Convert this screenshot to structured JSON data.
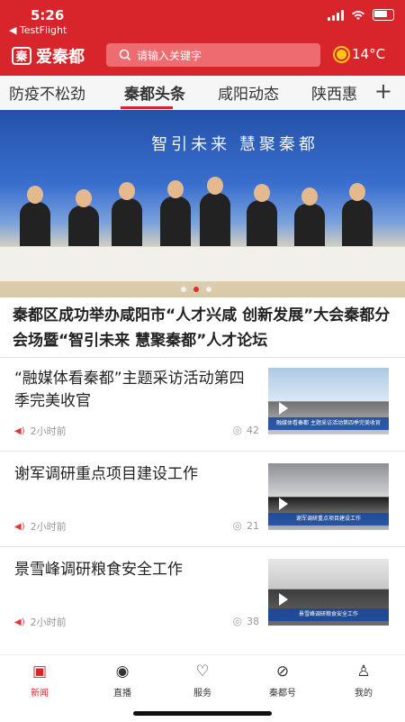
{
  "status_bar": {
    "time": "5:26",
    "back_app": "◀ TestFlight"
  },
  "app": {
    "name": "爱秦都",
    "logo_glyph": "秦"
  },
  "search": {
    "placeholder": "请输入关键字"
  },
  "weather": {
    "temperature": "14°C"
  },
  "tabs": [
    {
      "label": "防疫不松劲"
    },
    {
      "label": "秦都头条"
    },
    {
      "label": "咸阳动态"
    },
    {
      "label": "陕西惠"
    }
  ],
  "banner": {
    "sign_text": "智引未来 慧聚秦都",
    "carousel_active_index": 1
  },
  "headline": "秦都区成功举办咸阳市“人才兴咸 创新发展”大会秦都分会场暨“智引未来 慧聚秦都”人才论坛",
  "news": [
    {
      "title": "“融媒体看秦都”主题采访活动第四季完美收官",
      "time": "2小时前",
      "views": "42",
      "thumb_caption": "融媒体看秦都 主题采访活动第四季完美收官"
    },
    {
      "title": "谢军调研重点项目建设工作",
      "time": "2小时前",
      "views": "21",
      "thumb_caption": "谢军调研重点项目建设工作"
    },
    {
      "title": "景雪峰调研粮食安全工作",
      "time": "2小时前",
      "views": "38",
      "thumb_caption": "景雪峰调研粮食安全工作"
    }
  ],
  "bottom_nav": [
    {
      "label": "新闻",
      "icon": "news-icon"
    },
    {
      "label": "直播",
      "icon": "live-icon"
    },
    {
      "label": "服务",
      "icon": "service-icon"
    },
    {
      "label": "秦都号",
      "icon": "compass-icon"
    },
    {
      "label": "我的",
      "icon": "person-icon"
    }
  ],
  "colors": {
    "brand": "#d8242b",
    "search_bg": "#ee6b6f",
    "carousel_active": "#e02d2d"
  }
}
